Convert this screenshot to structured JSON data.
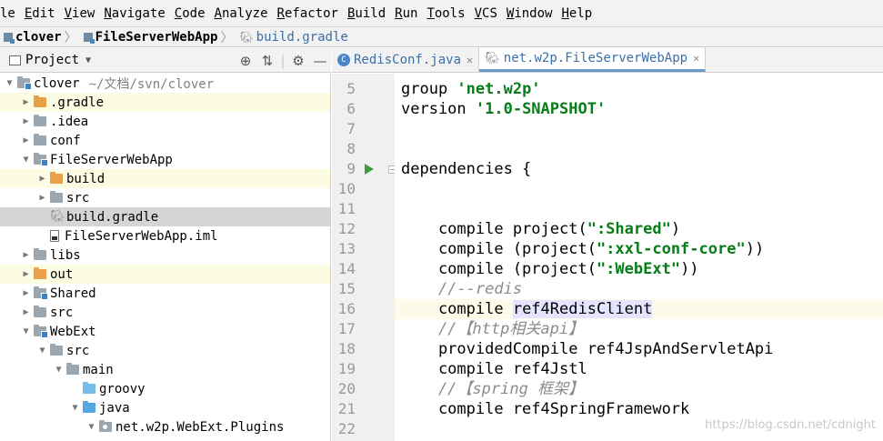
{
  "menu": [
    "le",
    "Edit",
    "View",
    "Navigate",
    "Code",
    "Analyze",
    "Refactor",
    "Build",
    "Run",
    "Tools",
    "VCS",
    "Window",
    "Help"
  ],
  "breadcrumb": {
    "root": "clover",
    "module": "FileServerWebApp",
    "file": "build.gradle"
  },
  "project_panel": {
    "title": "Project",
    "tools": [
      "target-icon",
      "collapse-icon",
      "gear-icon",
      "minimize-icon"
    ]
  },
  "tree": [
    {
      "label": "clover",
      "path": "~/文档/svn/clover",
      "indent": 0,
      "arrow": "down",
      "icon": "module",
      "hl": false,
      "sel": false
    },
    {
      "label": ".gradle",
      "indent": 1,
      "arrow": "right",
      "icon": "folder-orange",
      "hl": true,
      "sel": false
    },
    {
      "label": ".idea",
      "indent": 1,
      "arrow": "right",
      "icon": "folder",
      "hl": false,
      "sel": false
    },
    {
      "label": "conf",
      "indent": 1,
      "arrow": "right",
      "icon": "folder",
      "hl": false,
      "sel": false
    },
    {
      "label": "FileServerWebApp",
      "indent": 1,
      "arrow": "down",
      "icon": "module",
      "hl": false,
      "sel": false
    },
    {
      "label": "build",
      "indent": 2,
      "arrow": "right",
      "icon": "folder-orange",
      "hl": true,
      "sel": false
    },
    {
      "label": "src",
      "indent": 2,
      "arrow": "right",
      "icon": "folder",
      "hl": false,
      "sel": false
    },
    {
      "label": "build.gradle",
      "indent": 2,
      "arrow": "none",
      "icon": "gradle",
      "hl": false,
      "sel": true
    },
    {
      "label": "FileServerWebApp.iml",
      "indent": 2,
      "arrow": "none",
      "icon": "iml",
      "hl": false,
      "sel": false
    },
    {
      "label": "libs",
      "indent": 1,
      "arrow": "right",
      "icon": "folder",
      "hl": false,
      "sel": false
    },
    {
      "label": "out",
      "indent": 1,
      "arrow": "right",
      "icon": "folder-orange",
      "hl": true,
      "sel": false
    },
    {
      "label": "Shared",
      "indent": 1,
      "arrow": "right",
      "icon": "module",
      "hl": false,
      "sel": false
    },
    {
      "label": "src",
      "indent": 1,
      "arrow": "right",
      "icon": "folder",
      "hl": false,
      "sel": false
    },
    {
      "label": "WebExt",
      "indent": 1,
      "arrow": "down",
      "icon": "module",
      "hl": false,
      "sel": false
    },
    {
      "label": "src",
      "indent": 2,
      "arrow": "down",
      "icon": "folder",
      "hl": false,
      "sel": false
    },
    {
      "label": "main",
      "indent": 3,
      "arrow": "down",
      "icon": "folder",
      "hl": false,
      "sel": false
    },
    {
      "label": "groovy",
      "indent": 4,
      "arrow": "none",
      "icon": "folder-lightblue",
      "hl": false,
      "sel": false
    },
    {
      "label": "java",
      "indent": 4,
      "arrow": "down",
      "icon": "folder-blue",
      "hl": false,
      "sel": false
    },
    {
      "label": "net.w2p.WebExt.Plugins",
      "indent": 5,
      "arrow": "down",
      "icon": "package",
      "hl": false,
      "sel": false
    }
  ],
  "tabs": [
    {
      "label": "RedisConf.java",
      "icon": "java-class-icon",
      "active": false
    },
    {
      "label": "net.w2p.FileServerWebApp",
      "icon": "gradle-icon",
      "active": true
    }
  ],
  "code_lines": [
    {
      "n": "5",
      "segs": [
        {
          "t": "group "
        },
        {
          "t": "'net.w2p'",
          "c": "str"
        }
      ]
    },
    {
      "n": "6",
      "segs": [
        {
          "t": "version "
        },
        {
          "t": "'1.0-SNAPSHOT'",
          "c": "str"
        }
      ]
    },
    {
      "n": "7",
      "segs": []
    },
    {
      "n": "8",
      "segs": []
    },
    {
      "n": "9",
      "segs": [
        {
          "t": "dependencies {"
        }
      ],
      "run": true,
      "fold": true
    },
    {
      "n": "10",
      "segs": []
    },
    {
      "n": "11",
      "segs": []
    },
    {
      "n": "12",
      "segs": [
        {
          "t": "    compile project("
        },
        {
          "t": "\":Shared\"",
          "c": "str"
        },
        {
          "t": ")"
        }
      ]
    },
    {
      "n": "13",
      "segs": [
        {
          "t": "    compile (project("
        },
        {
          "t": "\":xxl-conf-core\"",
          "c": "str"
        },
        {
          "t": "))"
        }
      ]
    },
    {
      "n": "14",
      "segs": [
        {
          "t": "    compile (project("
        },
        {
          "t": "\":WebExt\"",
          "c": "str"
        },
        {
          "t": "))"
        }
      ]
    },
    {
      "n": "15",
      "segs": [
        {
          "t": "    //--redis",
          "c": "cmt"
        }
      ]
    },
    {
      "n": "16",
      "segs": [
        {
          "t": "    compile "
        },
        {
          "t": "ref4RedisClient",
          "c": "hl"
        }
      ],
      "cur": true,
      "bulb": true
    },
    {
      "n": "17",
      "segs": [
        {
          "t": "    //【http相关api】",
          "c": "cmt"
        }
      ]
    },
    {
      "n": "18",
      "segs": [
        {
          "t": "    providedCompile ref4JspAndServletApi"
        }
      ]
    },
    {
      "n": "19",
      "segs": [
        {
          "t": "    compile ref4Jstl"
        }
      ]
    },
    {
      "n": "20",
      "segs": [
        {
          "t": "    //【spring 框架】",
          "c": "cmt"
        }
      ]
    },
    {
      "n": "21",
      "segs": [
        {
          "t": "    compile ref4SpringFramework"
        }
      ]
    },
    {
      "n": "22",
      "segs": []
    }
  ],
  "watermark": "https://blog.csdn.net/cdnight",
  "colors": {
    "string": "#067d17",
    "comment": "#8c8c8c",
    "selection": "#d5d5d5",
    "highlight_row": "#fcfce3",
    "current_line": "#fcfae8"
  }
}
